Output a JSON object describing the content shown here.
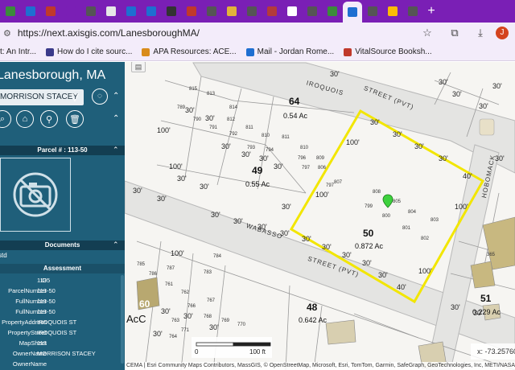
{
  "browser": {
    "url": "https://next.axisgis.com/LanesboroughMA/",
    "profile_initial": "J",
    "bookmarks": [
      {
        "label": "t: An Intr...",
        "color": "#4a4a4a"
      },
      {
        "label": "How do I cite sourc...",
        "color": "#3a3a8a"
      },
      {
        "label": "APA Resources: ACE...",
        "color": "#d98c1a"
      },
      {
        "label": "Mail - Jordan Rome...",
        "color": "#1e6fd1"
      },
      {
        "label": "VitalSource Booksh...",
        "color": "#c0392b"
      }
    ],
    "tab_colors": [
      "#3b8b3b",
      "#1e6fd1",
      "#c0392b",
      "#7a1fb5",
      "#555555",
      "#e7e7e7",
      "#1e6fd1",
      "#1e6fd1",
      "#333333",
      "#c0392b",
      "#555555",
      "#e2b33b",
      "#555555",
      "#b33b3b",
      "#ffffff",
      "#555555",
      "#3b8b3b",
      "#1e6fd1",
      "#555555",
      "#fbbc05",
      "#555555"
    ]
  },
  "panel": {
    "title": "Lanesborough, MA",
    "owner_search": "MORRISON STACEY",
    "parcel_header": "Parcel # : 113-50",
    "documents_header": "Documents",
    "documents_item": "std",
    "assessment_header": "Assessment",
    "rows": [
      {
        "key": "ID",
        "value": "1135"
      },
      {
        "key": "ParcelNumber",
        "value": "113-50"
      },
      {
        "key": "FullNumber",
        "value": "113-50"
      },
      {
        "key": "FullNumber",
        "value": "113-50"
      },
      {
        "key": "PropertyAddress",
        "value": "IROQUOIS ST"
      },
      {
        "key": "PropertyStreet",
        "value": "IROQUOIS ST"
      },
      {
        "key": "MapSheet",
        "value": "113"
      },
      {
        "key": "OwnerName",
        "value": "MORRISON STACEY"
      },
      {
        "key": "OwnerName",
        "value": ""
      }
    ]
  },
  "map": {
    "lot_64": "64",
    "lot_64_area": "0.54 Ac",
    "lot_49": "49",
    "lot_49_area": "0.55 Ac",
    "lot_50": "50",
    "lot_50_area": "0.872 Ac",
    "lot_48": "48",
    "lot_48_area": "0.642 Ac",
    "lot_51": "51",
    "lot_51_area": "0.229 Ac",
    "lot_60": "60",
    "street_iroquois": "IROQUOIS",
    "street_iroquois2": "STREET (PVT)",
    "street_wabasso": "WABASSO",
    "street_wabasso2": "STREET (PVT)",
    "street_hobomack": "HOBOMACK",
    "acc": "AcC",
    "highlight_color": "#f2e600",
    "scale_left": "0",
    "scale_right": "100 ft",
    "coordinate": "x: -73.25760",
    "attribution": "CEMA | Esri Community Maps Contributors, MassGIS, © OpenStreetMap, Microsoft, Esri, TomTom, Garmin, SafeGraph, GeoTechnologies, Inc, METI/NASA, USGS, EPA, NPS, US Census B"
  }
}
